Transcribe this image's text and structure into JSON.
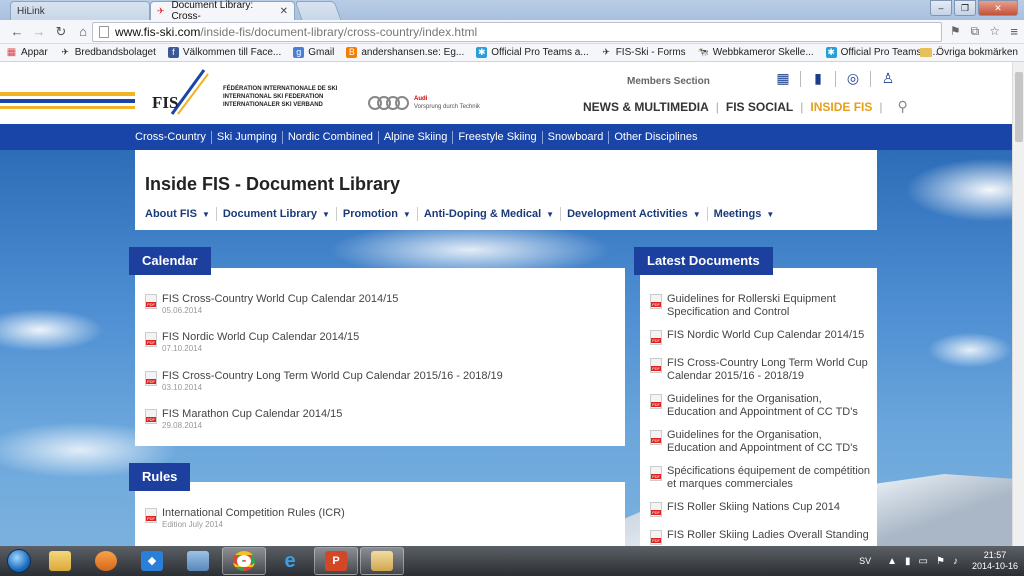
{
  "browser": {
    "tabs": [
      {
        "title": "HiLink",
        "active": false
      },
      {
        "title": "Document Library: Cross-",
        "active": true
      }
    ],
    "url_domain": "www.fis-ski.com",
    "url_path": "/inside-fis/document-library/cross-country/index.html",
    "bookmarks": [
      {
        "label": "Appar",
        "icon": "apps-icon"
      },
      {
        "label": "Bredbandsbolaget",
        "icon": "bookmark-icon"
      },
      {
        "label": "Välkommen till Face...",
        "icon": "facebook-icon"
      },
      {
        "label": "Gmail",
        "icon": "gmail-icon"
      },
      {
        "label": "andershansen.se: Eg...",
        "icon": "blogger-icon"
      },
      {
        "label": "Official Pro Teams a...",
        "icon": "site-icon"
      },
      {
        "label": "FIS-Ski - Forms",
        "icon": "fis-icon"
      },
      {
        "label": "Webbkameror Skelle...",
        "icon": "webcam-icon"
      },
      {
        "label": "Official Pro Teams a...",
        "icon": "site-icon"
      }
    ],
    "other_bookmarks": "Övriga bokmärken"
  },
  "header": {
    "federation_lines": [
      "FÉDÉRATION INTERNATIONALE DE SKI",
      "INTERNATIONAL SKI FEDERATION",
      "INTERNATIONALER SKI VERBAND"
    ],
    "logo_text": "FIS",
    "sponsor_brand": "Audi",
    "sponsor_slogan": "Vorsprung durch Technik",
    "members_section": "Members Section",
    "main_nav": [
      "NEWS & MULTIMEDIA",
      "FIS SOCIAL",
      "INSIDE FIS"
    ],
    "stripe_colors": [
      "#f0b323",
      "#1944a8",
      "#f0b323"
    ]
  },
  "disciplines": [
    "Cross-Country",
    "Ski Jumping",
    "Nordic Combined",
    "Alpine Skiing",
    "Freestyle Skiing",
    "Snowboard",
    "Other Disciplines"
  ],
  "page": {
    "title": "Inside FIS - Document Library",
    "subnav": [
      "About FIS",
      "Document Library",
      "Promotion",
      "Anti-Doping & Medical",
      "Development Activities",
      "Meetings"
    ]
  },
  "calendar": {
    "heading": "Calendar",
    "items": [
      {
        "title": "FIS Cross-Country World Cup Calendar 2014/15",
        "date": "05.06.2014"
      },
      {
        "title": "FIS Nordic World Cup Calendar 2014/15",
        "date": "07.10.2014"
      },
      {
        "title": "FIS Cross-Country Long Term World Cup Calendar 2015/16 - 2018/19",
        "date": "03.10.2014"
      },
      {
        "title": "FIS Marathon Cup Calendar 2014/15",
        "date": "29.08.2014"
      }
    ]
  },
  "rules": {
    "heading": "Rules",
    "items": [
      {
        "title": "International Competition Rules (ICR)",
        "date": "Edition July 2014"
      }
    ]
  },
  "latest": {
    "heading": "Latest Documents",
    "items": [
      {
        "title": "Guidelines for Rollerski Equipment Specification and Control"
      },
      {
        "title": "FIS Nordic World Cup Calendar 2014/15"
      },
      {
        "title": "FIS Cross-Country Long Term World Cup Calendar 2015/16 - 2018/19"
      },
      {
        "title": "Guidelines for the Organisation, Education and Appointment of CC TD's"
      },
      {
        "title": "Guidelines for the Organisation, Education and Appointment of CC TD's"
      },
      {
        "title": "Spécifications équipement de compétition et marques commerciales"
      },
      {
        "title": "FIS Roller Skiing Nations Cup 2014"
      },
      {
        "title": "FIS Roller Skiing Ladies Overall Standing"
      }
    ]
  },
  "taskbar": {
    "apps": [
      "explorer-icon",
      "media-player-icon",
      "dropbox-icon",
      "app-icon",
      "chrome-icon",
      "ie-icon",
      "powerpoint-icon",
      "folder-icon"
    ],
    "language": "SV",
    "time": "21:57",
    "date": "2014-10-16"
  }
}
